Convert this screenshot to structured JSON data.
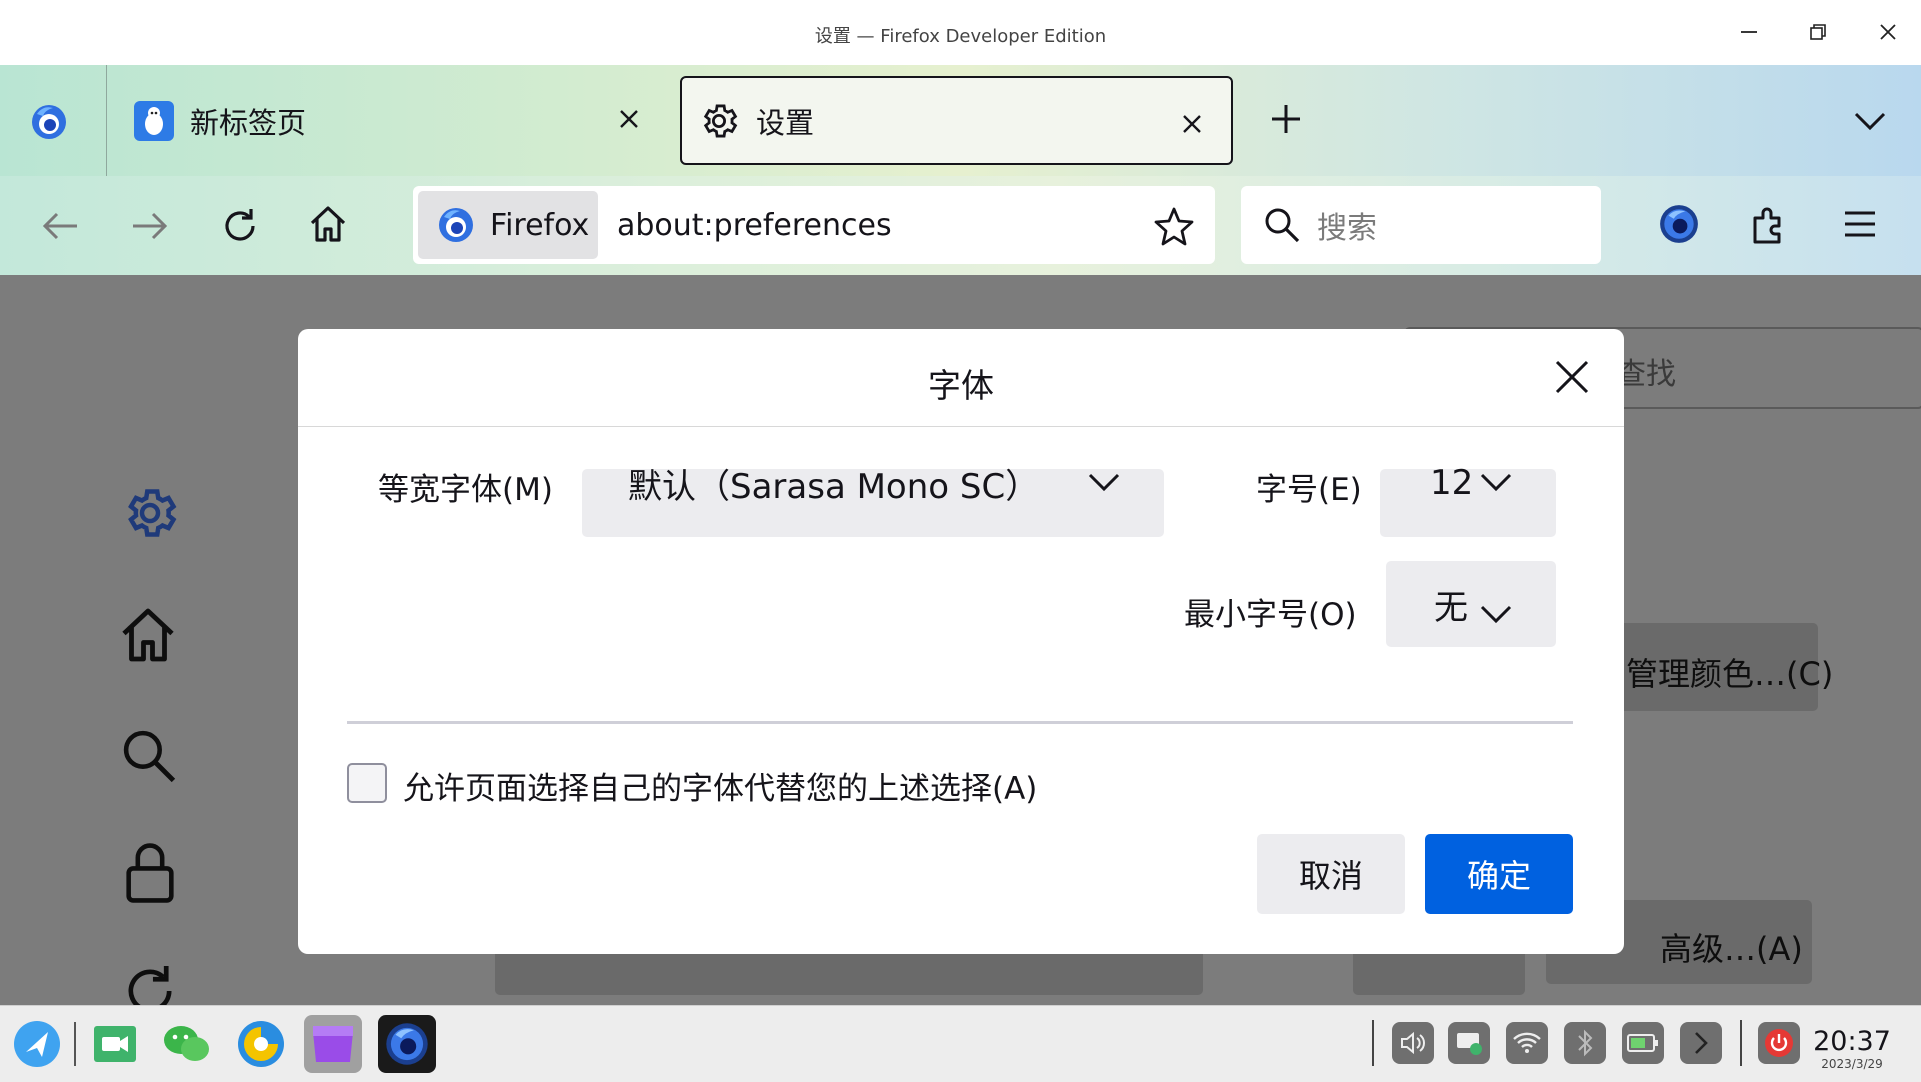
{
  "window": {
    "title": "设置 — Firefox Developer Edition"
  },
  "tabs": [
    {
      "label": "新标签页",
      "icon": "new-tab-penguin-icon"
    },
    {
      "label": "设置",
      "icon": "gear-icon"
    }
  ],
  "navbar": {
    "identity_label": "Firefox",
    "url": "about:preferences",
    "search_placeholder": "搜索"
  },
  "background": {
    "find_placeholder": "查找",
    "manage_colors_label": "管理颜色…(C)",
    "advanced_label": "高级…(A)"
  },
  "dialog": {
    "title": "字体",
    "monospace_label": "等宽字体(M)",
    "monospace_value": "默认（Sarasa Mono SC）",
    "size_label": "字号(E)",
    "size_value": "12",
    "min_size_label": "最小字号(O)",
    "min_size_value": "无",
    "allow_fonts_label": "允许页面选择自己的字体代替您的上述选择(A)",
    "allow_fonts_checked": false,
    "cancel_label": "取消",
    "ok_label": "确定"
  },
  "taskbar": {
    "time": "20:37",
    "date": "2023/3/29"
  },
  "colors": {
    "accent": "#0061e0",
    "overlay": "#7c7c7c",
    "sidebar_icon": "#1f3a7a",
    "power": "#e53935"
  }
}
